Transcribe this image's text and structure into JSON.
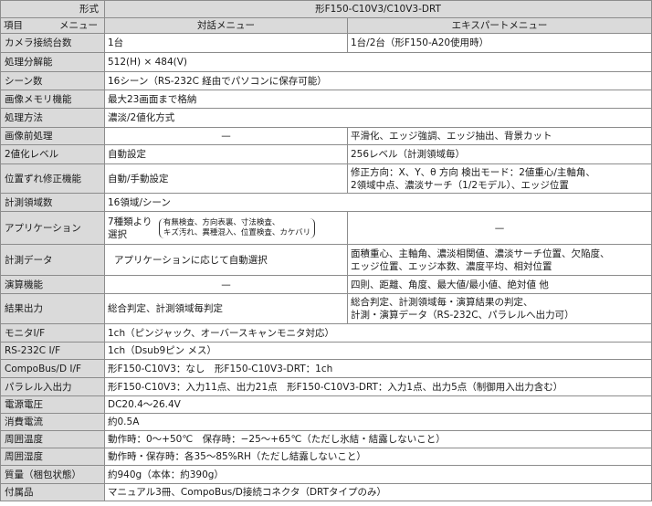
{
  "header": {
    "row1_label": "形式",
    "row1_value": "形F150-C10V3/C10V3-DRT",
    "row2_item": "項目",
    "row2_menu": "メニュー",
    "col_dialog": "対話メニュー",
    "col_expert": "エキスパートメニュー"
  },
  "rows": {
    "camera": {
      "label": "カメラ接続台数",
      "dialog": "1台",
      "expert": "1台/2台（形F150-A20使用時）"
    },
    "resolution": {
      "label": "処理分解能",
      "value": "512(H) × 484(V)"
    },
    "scenes": {
      "label": "シーン数",
      "value": "16シーン（RS-232C 経由でパソコンに保存可能）"
    },
    "memory": {
      "label": "画像メモリ機能",
      "value": "最大23画面まで格納"
    },
    "method": {
      "label": "処理方法",
      "value": "濃淡/2値化方式"
    },
    "preproc": {
      "label": "画像前処理",
      "dialog": "—",
      "expert": "平滑化、エッジ強調、エッジ抽出、背景カット"
    },
    "binlevel": {
      "label": "2値化レベル",
      "dialog": "自動設定",
      "expert": "256レベル（計測領域毎）"
    },
    "poscorr": {
      "label": "位置ずれ修正機能",
      "dialog": "自動/手動設定",
      "expert_line1": "修正方向：X、Y、θ 方向 検出モード：2値重心/主軸角、",
      "expert_line2": "2領域中点、濃淡サーチ（1/2モデル）、エッジ位置"
    },
    "regions": {
      "label": "計測領域数",
      "value": "16領域/シーン"
    },
    "app": {
      "label": "アプリケーション",
      "dialog_line1": "7種類より",
      "dialog_line2": "選択",
      "paren_line1": "有無検査、方向表裏、寸法検査、",
      "paren_line2": "キズ汚れ、異種混入、位置検査、カケバリ",
      "expert": "—"
    },
    "measure": {
      "label": "計測データ",
      "dialog": "アプリケーションに応じて自動選択",
      "expert_line1": "面積重心、主軸角、濃淡相関値、濃淡サーチ位置、欠陥度、",
      "expert_line2": "エッジ位置、エッジ本数、濃度平均、相対位置"
    },
    "calc": {
      "label": "演算機能",
      "dialog": "—",
      "expert": "四則、距離、角度、最大値/最小値、絶対値 他"
    },
    "output": {
      "label": "結果出力",
      "dialog": "総合判定、計測領域毎判定",
      "expert_line1": "総合判定、計測領域毎・演算結果の判定、",
      "expert_line2": "計測・演算データ（RS-232C、パラレルへ出力可）"
    },
    "monitor": {
      "label": "モニタI/F",
      "value": "1ch（ピンジャック、オーバースキャンモニタ対応）"
    },
    "rs232": {
      "label": "RS-232C I/F",
      "value": "1ch（Dsub9ピン メス）"
    },
    "compobus": {
      "label": "CompoBus/D I/F",
      "value": "形F150-C10V3：なし　形F150-C10V3-DRT：1ch"
    },
    "parallel": {
      "label": "パラレル入出力",
      "value": "形F150-C10V3：入力11点、出力21点　形F150-C10V3-DRT：入力1点、出力5点（制御用入出力含む）"
    },
    "voltage": {
      "label": "電源電圧",
      "value": "DC20.4～26.4V"
    },
    "current": {
      "label": "消費電流",
      "value": "約0.5A"
    },
    "temp": {
      "label": "周囲温度",
      "value": "動作時：0～+50℃　保存時：−25～+65℃（ただし氷結・結露しないこと）"
    },
    "humidity": {
      "label": "周囲湿度",
      "value": "動作時・保存時：各35～85%RH（ただし結露しないこと）"
    },
    "mass": {
      "label": "質量（梱包状態）",
      "value": "約940g（本体：約390g）"
    },
    "accessories": {
      "label": "付属品",
      "value": "マニュアル3冊、CompoBus/D接続コネクタ（DRTタイプのみ）"
    }
  }
}
